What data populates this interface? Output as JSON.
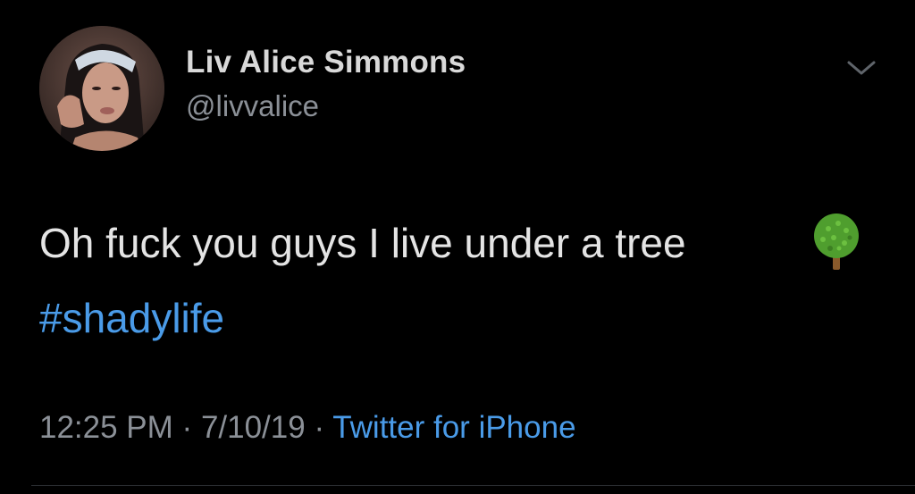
{
  "user": {
    "display_name": "Liv Alice Simmons",
    "handle": "@livvalice"
  },
  "tweet": {
    "text": "Oh fuck you guys I live under a tree",
    "emoji": "deciduous-tree-icon",
    "hashtag": "#shadylife",
    "time": "12:25 PM",
    "separator": "·",
    "date": "7/10/19",
    "source": "Twitter for iPhone"
  },
  "colors": {
    "background": "#000000",
    "link": "#4a9be8",
    "muted": "#8b9097",
    "text": "#e4e4e4"
  }
}
